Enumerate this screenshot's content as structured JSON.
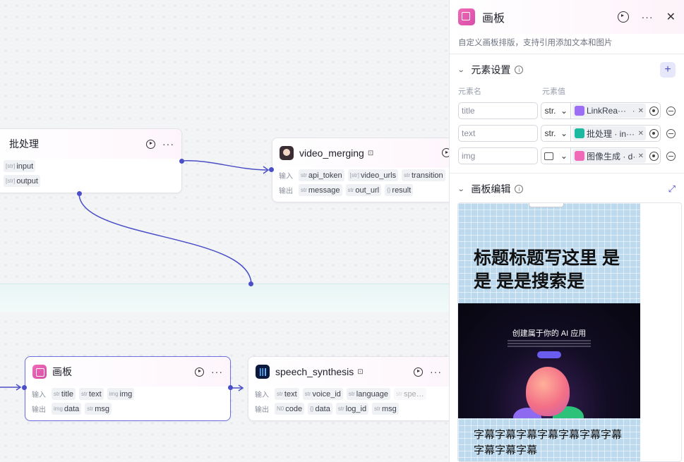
{
  "nodes": {
    "batch": {
      "title": "批处理",
      "rows": [
        {
          "type": "[str]",
          "name": "input"
        },
        {
          "type": "[str]",
          "name": "output"
        }
      ]
    },
    "video_merging": {
      "title": "video_merging",
      "input_label": "输入",
      "output_label": "输出",
      "inputs": [
        {
          "type": "str",
          "name": "api_token"
        },
        {
          "type": "[str]",
          "name": "video_urls"
        },
        {
          "type": "str",
          "name": "transition"
        }
      ],
      "outputs": [
        {
          "type": "str",
          "name": "message"
        },
        {
          "type": "str",
          "name": "out_url"
        },
        {
          "type": "{}",
          "name": "result"
        }
      ]
    },
    "canvas": {
      "title": "画板",
      "input_label": "输入",
      "output_label": "输出",
      "inputs": [
        {
          "type": "str",
          "name": "title"
        },
        {
          "type": "str",
          "name": "text"
        },
        {
          "type": "img",
          "name": "img"
        }
      ],
      "outputs": [
        {
          "type": "img",
          "name": "data"
        },
        {
          "type": "str",
          "name": "msg"
        }
      ]
    },
    "speech_synthesis": {
      "title": "speech_synthesis",
      "input_label": "输入",
      "output_label": "输出",
      "inputs": [
        {
          "type": "str",
          "name": "text"
        },
        {
          "type": "str",
          "name": "voice_id"
        },
        {
          "type": "str",
          "name": "language"
        },
        {
          "type": "str",
          "name": "spe…"
        }
      ],
      "outputs": [
        {
          "type": "N0",
          "name": "code"
        },
        {
          "type": "{}",
          "name": "data"
        },
        {
          "type": "str",
          "name": "log_id"
        },
        {
          "type": "str",
          "name": "msg"
        }
      ]
    }
  },
  "panel": {
    "title": "画板",
    "description": "自定义画板排版，支持引用添加文本和图片",
    "element_settings": {
      "heading": "元素设置",
      "col_name": "元素名",
      "col_value": "元素值",
      "rows": [
        {
          "name": "title",
          "type": "str.",
          "value": "LinkRea···",
          "value_suffix": "·"
        },
        {
          "name": "text",
          "type": "str.",
          "value": "批处理 · in···"
        },
        {
          "name": "img",
          "type": "",
          "value": "图像生成 · d···"
        }
      ]
    },
    "board_edit": {
      "heading": "画板编辑",
      "title_text": "标题标题写这里 是 是 是是搜索是",
      "screenshot_title": "创建属于你的 AI 应用",
      "subtitle_text": "字幕字幕字幕字幕字幕字幕字幕字幕字幕字幕"
    }
  },
  "colors": {
    "accent": "#4b4fc7",
    "canvas_icon": "#f06ab8"
  }
}
